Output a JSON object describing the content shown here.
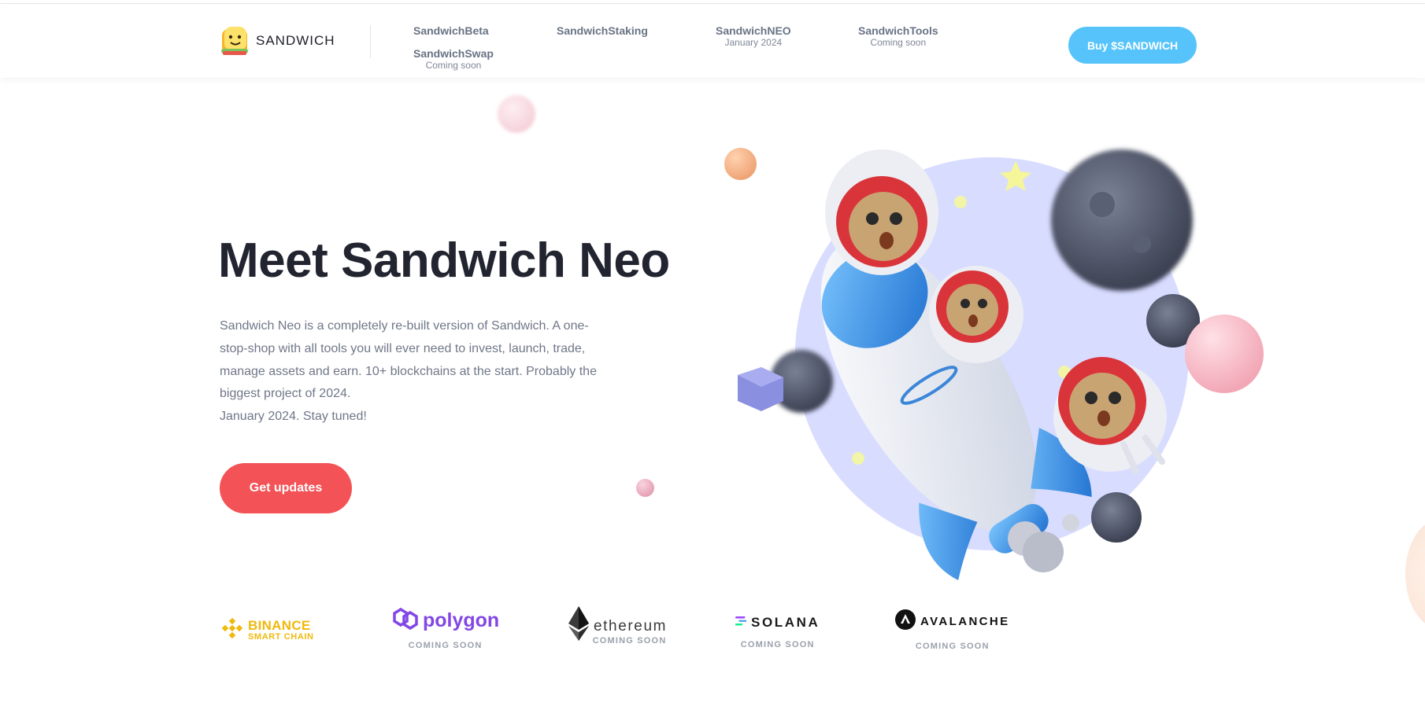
{
  "brand": {
    "name": "SANDWICH",
    "logo_icon": "sandwich-logo-icon"
  },
  "nav": {
    "items": [
      {
        "label": "SandwichBeta",
        "sub": ""
      },
      {
        "label": "SandwichStaking",
        "sub": ""
      },
      {
        "label": "SandwichNEO",
        "sub": "January 2024"
      },
      {
        "label": "SandwichTools",
        "sub": "Coming soon"
      },
      {
        "label": "SandwichSwap",
        "sub": "Coming soon"
      }
    ],
    "buy_label": "Buy $SANDWICH"
  },
  "hero": {
    "title": "Meet Sandwich Neo",
    "description_lines": [
      "Sandwich Neo is a completely re-built version of Sandwich. A one-",
      "stop-shop with all tools you will ever need to invest, launch, trade,",
      "manage assets and earn. 10+ blockchains at the start. Probably the",
      "biggest project of 2024.",
      "January 2024. Stay tuned!"
    ],
    "cta_label": "Get updates",
    "illustration_icon": "rocket-astronauts-illustration"
  },
  "chains": [
    {
      "name": "BINANCE",
      "tagline": "SMART CHAIN",
      "status": "",
      "icon": "binance-logo-icon"
    },
    {
      "name": "polygon",
      "tagline": "",
      "status": "COMING SOON",
      "icon": "polygon-logo-icon"
    },
    {
      "name": "ethereum",
      "tagline": "",
      "status": "COMING SOON",
      "icon": "ethereum-logo-icon"
    },
    {
      "name": "SOLANA",
      "tagline": "",
      "status": "COMING SOON",
      "icon": "solana-logo-icon"
    },
    {
      "name": "AVALANCHE",
      "tagline": "",
      "status": "COMING SOON",
      "icon": "avalanche-logo-icon"
    }
  ],
  "colors": {
    "accent_blue": "#56c4fb",
    "cta_red": "#f35256",
    "title_dark": "#222530",
    "binance_yellow": "#f0b90b",
    "polygon_purple": "#8247e5"
  }
}
